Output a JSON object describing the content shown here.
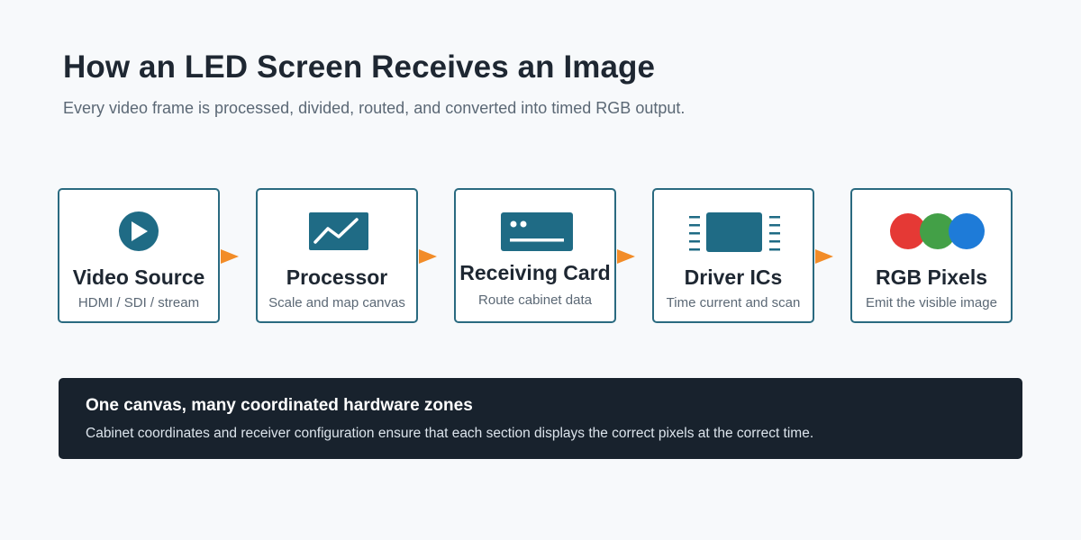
{
  "header": {
    "title": "How an LED Screen Receives an Image",
    "subtitle": "Every video frame is processed, divided, routed, and converted into timed RGB output."
  },
  "stages": [
    {
      "icon": "play-icon",
      "title": "Video Source",
      "subtitle": "HDMI / SDI / stream"
    },
    {
      "icon": "line-chart-icon",
      "title": "Processor",
      "subtitle": "Scale and map canvas"
    },
    {
      "icon": "receiving-card-icon",
      "title": "Receiving Card",
      "subtitle": "Route cabinet data"
    },
    {
      "icon": "chip-icon",
      "title": "Driver ICs",
      "subtitle": "Time current and scan"
    },
    {
      "icon": "rgb-circles-icon",
      "title": "RGB Pixels",
      "subtitle": "Emit the visible image"
    }
  ],
  "banner": {
    "title": "One canvas, many coordinated hardware zones",
    "text": "Cabinet coordinates and receiver configuration ensure that each section displays the correct pixels at the correct time."
  },
  "colors": {
    "accent": "#2a6a80",
    "icon_fill": "#1f6b85",
    "arrow": "#f28c28",
    "banner_bg": "#18222d",
    "red": "#e53935",
    "green": "#43a047",
    "blue": "#1e7bd8"
  }
}
